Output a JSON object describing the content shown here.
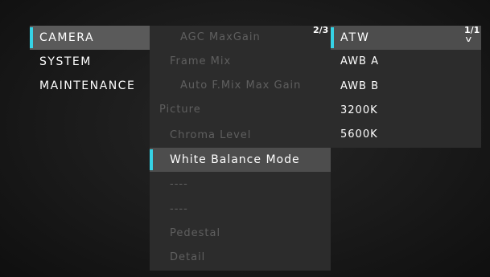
{
  "left_menu": {
    "items": [
      {
        "label": "CAMERA",
        "selected": true
      },
      {
        "label": "SYSTEM",
        "selected": false
      },
      {
        "label": "MAINTENANCE",
        "selected": false
      }
    ]
  },
  "middle_menu": {
    "page": "2/3",
    "items": [
      {
        "label": "AGC MaxGain"
      },
      {
        "label": "Frame Mix"
      },
      {
        "label": "Auto F.Mix Max Gain"
      },
      {
        "label": "Picture"
      },
      {
        "label": "Chroma Level"
      },
      {
        "label": "White Balance Mode",
        "selected": true
      },
      {
        "label": "----"
      },
      {
        "label": "----"
      },
      {
        "label": "Pedestal"
      },
      {
        "label": "Detail"
      }
    ]
  },
  "right_menu": {
    "page": "1/1",
    "scroll_indicator": "v",
    "items": [
      {
        "label": "ATW",
        "selected": true
      },
      {
        "label": "AWB A"
      },
      {
        "label": "AWB B"
      },
      {
        "label": "3200K"
      },
      {
        "label": "5600K"
      }
    ]
  },
  "colors": {
    "accent": "#36d3e6",
    "panel": "#2c2c2c",
    "highlight": "#4d4d4d",
    "dim_text": "#5f5f5f"
  }
}
